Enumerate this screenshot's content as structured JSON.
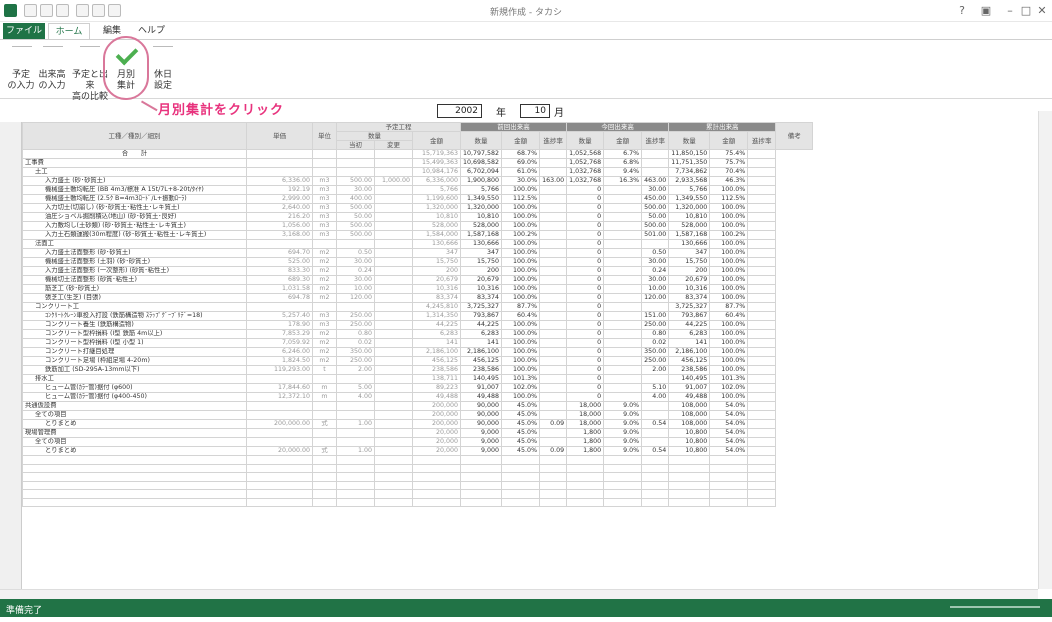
{
  "window": {
    "title": "新規作成 - タカシ"
  },
  "tabs": [
    "ファイル",
    "ホーム",
    "編集",
    "ヘルプ"
  ],
  "ribbon": {
    "buttons": [
      {
        "label1": "予定",
        "label2": "の入力"
      },
      {
        "label1": "出来高",
        "label2": "の入力"
      },
      {
        "label1": "予定と出来",
        "label2": "高の比較"
      },
      {
        "label1": "月別",
        "label2": "集計"
      },
      {
        "label1": "休日",
        "label2": "設定"
      }
    ],
    "callout": "月別集計をクリック"
  },
  "period": {
    "year": "2002",
    "year_label": "年",
    "month": "10",
    "month_label": "月"
  },
  "headers": {
    "item": "工種／種別／細別",
    "unit_price": "単価",
    "unit": "単位",
    "plan": "予定工程",
    "qty": "数量",
    "initial": "当初",
    "change": "変更",
    "amount": "金額",
    "prev": "前回出来高",
    "curr": "今回出来高",
    "total": "累計出来高",
    "q": "数量",
    "a": "金額",
    "rate": "進捗率",
    "note": "備考"
  },
  "rows": [
    [
      "合　　計",
      "",
      "",
      "",
      "",
      "15,719,363",
      "10,797,582",
      "68.7%",
      "",
      "1,052,568",
      "6.7%",
      "",
      "11,850,150",
      "75.4%"
    ],
    [
      "工事費",
      "",
      "",
      "",
      "",
      "15,499,363",
      "10,698,582",
      "69.0%",
      "",
      "1,052,768",
      "6.8%",
      "",
      "11,751,350",
      "75.7%"
    ],
    [
      "土工",
      "",
      "",
      "",
      "",
      "10,984,176",
      "6,702,094",
      "61.0%",
      "",
      "1,032,768",
      "9.4%",
      "",
      "7,734,862",
      "70.4%"
    ],
    [
      "入力盛土 (砂･砂質土)",
      "6,336.00",
      "m3",
      "500.00",
      "1,000.00",
      "6,336,000",
      "1,900,800",
      "30.0%",
      "163.00",
      "1,032,768",
      "16.3%",
      "463.00",
      "2,933,568",
      "46.3%"
    ],
    [
      "機械盛土敷均転圧 (BB 4m3/標准 A 15t/7L+8-20t/ﾀｲﾔ)",
      "192.19",
      "m3",
      "30.00",
      "",
      "5,766",
      "5,766",
      "100.0%",
      "",
      "0",
      "",
      "30.00",
      "5,766",
      "100.0%"
    ],
    [
      "機械盛土敷均転圧 (2.5ｸ B=4m3ﾛｰﾄﾞ/L+振動ﾛｰﾗ)",
      "2,999.00",
      "m3",
      "400.00",
      "",
      "1,199,600",
      "1,349,550",
      "112.5%",
      "",
      "0",
      "",
      "450.00",
      "1,349,550",
      "112.5%"
    ],
    [
      "入力切土(切崩し) (砂･砂質土･粘性土･レキ質土)",
      "2,640.00",
      "m3",
      "500.00",
      "",
      "1,320,000",
      "1,320,000",
      "100.0%",
      "",
      "0",
      "",
      "500.00",
      "1,320,000",
      "100.0%"
    ],
    [
      "油圧ショベル掘削積込(地山) (砂･砂質土･良好)",
      "216.20",
      "m3",
      "50.00",
      "",
      "10,810",
      "10,810",
      "100.0%",
      "",
      "0",
      "",
      "50.00",
      "10,810",
      "100.0%"
    ],
    [
      "入力敷均し(土砂類) (砂･砂質土･粘性土･レキ質土)",
      "1,056.00",
      "m3",
      "500.00",
      "",
      "528,000",
      "528,000",
      "100.0%",
      "",
      "0",
      "",
      "500.00",
      "528,000",
      "100.0%"
    ],
    [
      "入力土石類運搬(30m程度) (砂･砂質土･粘性土･レキ質土)",
      "3,168.00",
      "m3",
      "500.00",
      "",
      "1,584,000",
      "1,587,168",
      "100.2%",
      "",
      "0",
      "",
      "501.00",
      "1,587,168",
      "100.2%"
    ],
    [
      "法面工",
      "",
      "",
      "",
      "",
      "130,666",
      "130,666",
      "100.0%",
      "",
      "0",
      "",
      "",
      "130,666",
      "100.0%"
    ],
    [
      "入力盛土法面整形 (砂･砂質土)",
      "694.70",
      "m2",
      "0.50",
      "",
      "347",
      "347",
      "100.0%",
      "",
      "0",
      "",
      "0.50",
      "347",
      "100.0%"
    ],
    [
      "機械盛土法面整形 (土羽) (砂･砂質土)",
      "525.00",
      "m2",
      "30.00",
      "",
      "15,750",
      "15,750",
      "100.0%",
      "",
      "0",
      "",
      "30.00",
      "15,750",
      "100.0%"
    ],
    [
      "入力盛土法面整形 (一次整形) (砂質･粘性土)",
      "833.30",
      "m2",
      "0.24",
      "",
      "200",
      "200",
      "100.0%",
      "",
      "0",
      "",
      "0.24",
      "200",
      "100.0%"
    ],
    [
      "機械切土法面整形 (砂質･粘性土)",
      "689.30",
      "m2",
      "30.00",
      "",
      "20,679",
      "20,679",
      "100.0%",
      "",
      "0",
      "",
      "30.00",
      "20,679",
      "100.0%"
    ],
    [
      "筋芝工 (砂･砂質土)",
      "1,031.58",
      "m2",
      "10.00",
      "",
      "10,316",
      "10,316",
      "100.0%",
      "",
      "0",
      "",
      "10.00",
      "10,316",
      "100.0%"
    ],
    [
      "張芝工(生芝) (目張)",
      "694.78",
      "m2",
      "120.00",
      "",
      "83,374",
      "83,374",
      "100.0%",
      "",
      "0",
      "",
      "120.00",
      "83,374",
      "100.0%"
    ],
    [
      "コンクリート工",
      "",
      "",
      "",
      "",
      "4,245,810",
      "3,725,327",
      "87.7%",
      "",
      "0",
      "",
      "",
      "3,725,327",
      "87.7%"
    ],
    [
      "ｺﾝｸﾘｰﾄｸﾚｰﾝ車投入打設 (鉄筋構造物 ｽﾗｯﾌﾟｸﾞｰﾌﾞﾘﾃﾞ=18)",
      "5,257.40",
      "m3",
      "250.00",
      "",
      "1,314,350",
      "793,867",
      "60.4%",
      "",
      "0",
      "",
      "151.00",
      "793,867",
      "60.4%"
    ],
    [
      "コンクリート養生 (鉄筋構造物)",
      "178.90",
      "m3",
      "250.00",
      "",
      "44,225",
      "44,225",
      "100.0%",
      "",
      "0",
      "",
      "250.00",
      "44,225",
      "100.0%"
    ],
    [
      "コンクリート型枠損料 (I型 鉄筋 4m以上)",
      "7,853.29",
      "m2",
      "0.80",
      "",
      "6,283",
      "6,283",
      "100.0%",
      "",
      "0",
      "",
      "0.80",
      "6,283",
      "100.0%"
    ],
    [
      "コンクリート型枠損料 (I型 小型 1)",
      "7,059.92",
      "m2",
      "0.02",
      "",
      "141",
      "141",
      "100.0%",
      "",
      "0",
      "",
      "0.02",
      "141",
      "100.0%"
    ],
    [
      "コンクリート打継目処理",
      "6,246.00",
      "m2",
      "350.00",
      "",
      "2,186,100",
      "2,186,100",
      "100.0%",
      "",
      "0",
      "",
      "350.00",
      "2,186,100",
      "100.0%"
    ],
    [
      "コンクリート足場 (枠組足場 4-20m)",
      "1,824.50",
      "m2",
      "250.00",
      "",
      "456,125",
      "456,125",
      "100.0%",
      "",
      "0",
      "",
      "250.00",
      "456,125",
      "100.0%"
    ],
    [
      "鉄筋加工 (SD-295A-13mm以下)",
      "119,293.00",
      "t",
      "2.00",
      "",
      "238,586",
      "238,586",
      "100.0%",
      "",
      "0",
      "",
      "2.00",
      "238,586",
      "100.0%"
    ],
    [
      "排水工",
      "",
      "",
      "",
      "",
      "138,711",
      "140,495",
      "101.3%",
      "",
      "0",
      "",
      "",
      "140,495",
      "101.3%"
    ],
    [
      "ヒューム管(ｶﾗｰ管)据付 (φ600)",
      "17,844.60",
      "m",
      "5.00",
      "",
      "89,223",
      "91,007",
      "102.0%",
      "",
      "0",
      "",
      "5.10",
      "91,007",
      "102.0%"
    ],
    [
      "ヒューム管(ｶﾗｰ管)据付 (φ400-450)",
      "12,372.10",
      "m",
      "4.00",
      "",
      "49,488",
      "49,488",
      "100.0%",
      "",
      "0",
      "",
      "4.00",
      "49,488",
      "100.0%"
    ],
    [
      "共通仮設費",
      "",
      "",
      "",
      "",
      "200,000",
      "90,000",
      "45.0%",
      "",
      "18,000",
      "9.0%",
      "",
      "108,000",
      "54.0%"
    ],
    [
      "全ての項目",
      "",
      "",
      "",
      "",
      "200,000",
      "90,000",
      "45.0%",
      "",
      "18,000",
      "9.0%",
      "",
      "108,000",
      "54.0%"
    ],
    [
      "とりまとめ",
      "200,000.00",
      "式",
      "1.00",
      "",
      "200,000",
      "90,000",
      "45.0%",
      "0.09",
      "18,000",
      "9.0%",
      "0.54",
      "108,000",
      "54.0%"
    ],
    [
      "現場管理費",
      "",
      "",
      "",
      "",
      "20,000",
      "9,000",
      "45.0%",
      "",
      "1,800",
      "9.0%",
      "",
      "10,800",
      "54.0%"
    ],
    [
      "全ての項目",
      "",
      "",
      "",
      "",
      "20,000",
      "9,000",
      "45.0%",
      "",
      "1,800",
      "9.0%",
      "",
      "10,800",
      "54.0%"
    ],
    [
      "とりまとめ",
      "20,000.00",
      "式",
      "1.00",
      "",
      "20,000",
      "9,000",
      "45.0%",
      "0.09",
      "1,800",
      "9.0%",
      "0.54",
      "10,800",
      "54.0%"
    ]
  ],
  "status": "準備完了"
}
